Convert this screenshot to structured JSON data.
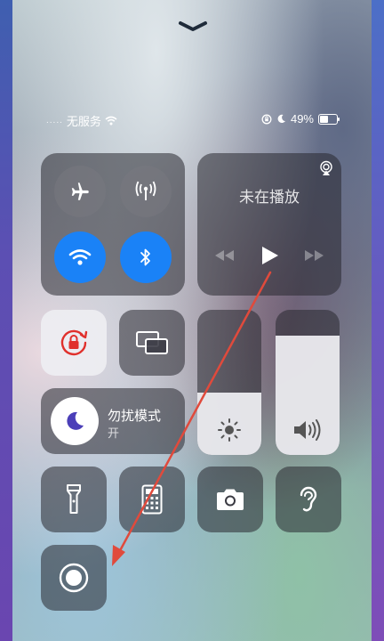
{
  "status_bar": {
    "signal_dots": ".....",
    "carrier": "无服务",
    "battery_percent": "49%",
    "battery_level": 0.49
  },
  "music": {
    "title": "未在播放"
  },
  "do_not_disturb": {
    "title": "勿扰模式",
    "state": "开"
  },
  "sliders": {
    "brightness_level": 0.43,
    "volume_level": 0.82
  },
  "colors": {
    "accent_blue": "#1a82f7",
    "rotation_lock_red": "#e0302c",
    "annotation_arrow": "#e04a3c"
  }
}
